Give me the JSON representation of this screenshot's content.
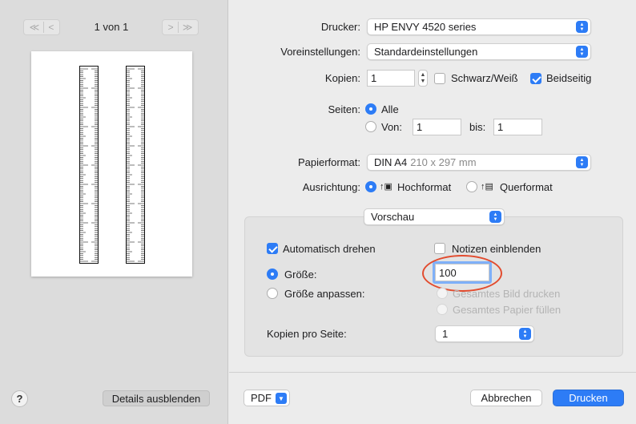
{
  "preview": {
    "page_counter": "1 von 1",
    "first_prev_glyphs": [
      "≪",
      "<"
    ],
    "next_last_glyphs": [
      ">",
      "≫"
    ],
    "help_label": "?",
    "details_button": "Details ausblenden"
  },
  "printer": {
    "label": "Drucker:",
    "value": "HP ENVY 4520 series"
  },
  "presets": {
    "label": "Voreinstellungen:",
    "value": "Standardeinstellungen"
  },
  "copies": {
    "label": "Kopien:",
    "value": "1",
    "bw_label": "Schwarz/Weiß",
    "bw_checked": false,
    "duplex_label": "Beidseitig",
    "duplex_checked": true
  },
  "pages": {
    "label": "Seiten:",
    "all_label": "Alle",
    "from_label": "Von:",
    "from_value": "1",
    "to_label": "bis:",
    "to_value": "1"
  },
  "paper": {
    "label": "Papierformat:",
    "value": "DIN A4",
    "size_hint": "210 x 297 mm"
  },
  "orientation": {
    "label": "Ausrichtung:",
    "portrait_label": "Hochformat",
    "landscape_label": "Querformat"
  },
  "section": {
    "value": "Vorschau"
  },
  "preview_options": {
    "auto_rotate_label": "Automatisch drehen",
    "show_notes_label": "Notizen einblenden",
    "size_label": "Größe:",
    "size_value": "100",
    "scale_to_fit_label": "Größe anpassen:",
    "print_entire_image_label": "Gesamtes Bild drucken",
    "fill_entire_paper_label": "Gesamtes Papier füllen",
    "pages_per_sheet_label": "Kopien pro Seite:",
    "pages_per_sheet_value": "1"
  },
  "footer": {
    "pdf_label": "PDF",
    "cancel_label": "Abbrechen",
    "print_label": "Drucken"
  },
  "colors": {
    "accent": "#2d7cf6",
    "highlight": "#e24b2e"
  }
}
